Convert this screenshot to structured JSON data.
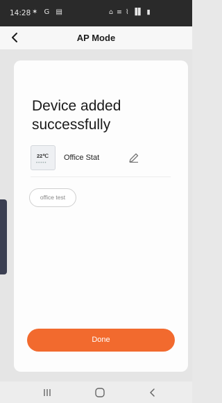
{
  "status_bar": {
    "time": "14:28",
    "left_icons": "✶ G ▤",
    "right_icons": "⌂ ≡ ⌇ ▐▌ ▮"
  },
  "header": {
    "title": "AP Mode",
    "back_icon": "chevron-left-icon"
  },
  "card": {
    "headline": "Device added successfully",
    "device": {
      "thumb_temp": "22℃",
      "thumb_dots": "•••••",
      "name": "Office Stat",
      "edit_icon": "pencil-icon"
    },
    "room_chip": "office test",
    "done_label": "Done"
  },
  "system_nav": {
    "recents_icon": "recent-apps-icon",
    "home_icon": "home-icon",
    "back_icon": "back-icon"
  },
  "colors": {
    "accent": "#f26a2e",
    "status_bar": "#2a2a2a",
    "background": "#e5e5e5",
    "card": "#fdfdfd"
  }
}
